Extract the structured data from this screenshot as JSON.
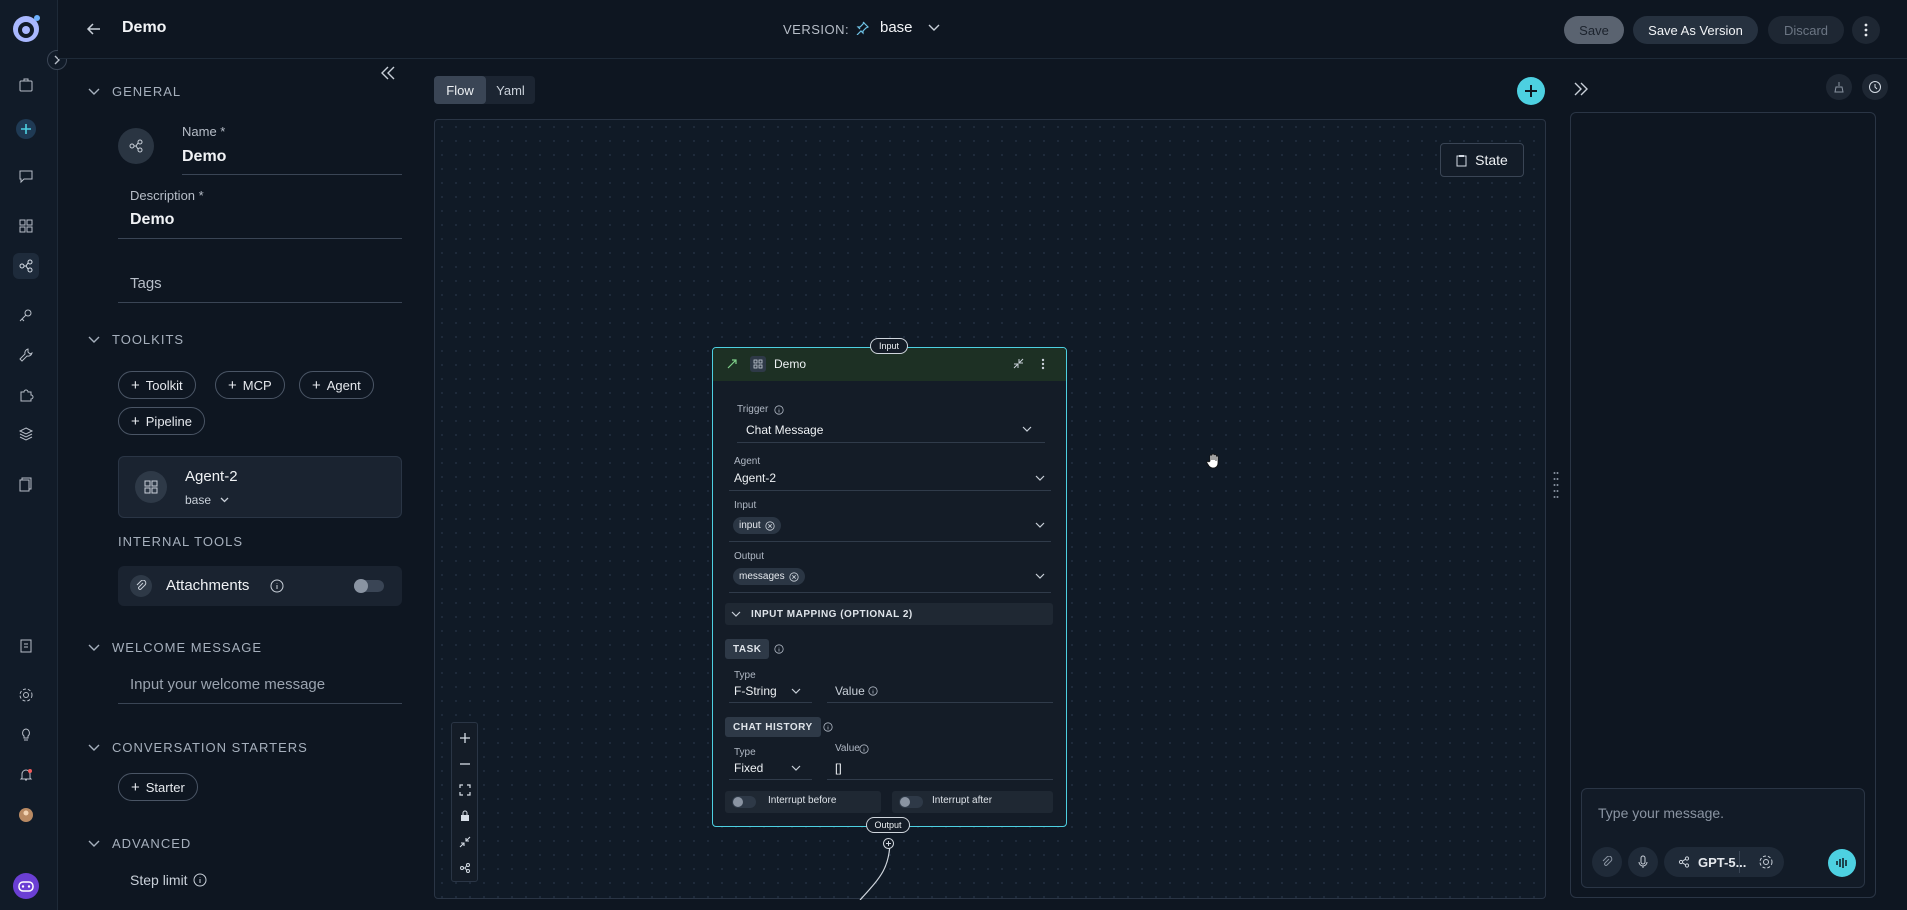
{
  "header": {
    "title": "Demo",
    "version_label": "VERSION:",
    "version_value": "base",
    "save": "Save",
    "save_as_version": "Save As Version",
    "discard": "Discard"
  },
  "general": {
    "section": "GENERAL",
    "name_label": "Name *",
    "name_value": "Demo",
    "description_label": "Description *",
    "description_value": "Demo",
    "tags_placeholder": "Tags"
  },
  "toolkits": {
    "section": "TOOLKITS",
    "buttons": [
      "Toolkit",
      "MCP",
      "Agent",
      "Pipeline"
    ],
    "agent_name": "Agent-2",
    "agent_version": "base"
  },
  "internal_tools": {
    "section": "INTERNAL TOOLS",
    "attachments": "Attachments",
    "attachments_enabled": false
  },
  "welcome": {
    "section": "WELCOME MESSAGE",
    "placeholder": "Input your welcome message"
  },
  "starters": {
    "section": "CONVERSATION STARTERS",
    "button": "Starter"
  },
  "advanced": {
    "section": "ADVANCED",
    "step_limit": "Step limit"
  },
  "canvas": {
    "tabs": [
      "Flow",
      "Yaml"
    ],
    "active_tab": "Flow",
    "state_button": "State"
  },
  "node": {
    "input_handle": "Input",
    "output_handle": "Output",
    "title": "Demo",
    "trigger_label": "Trigger",
    "trigger_value": "Chat Message",
    "agent_label": "Agent",
    "agent_value": "Agent-2",
    "input_label": "Input",
    "input_chip": "input",
    "output_label": "Output",
    "output_chip": "messages",
    "mapping_header": "INPUT MAPPING (OPTIONAL 2)",
    "task_tag": "TASK",
    "task_type_label": "Type",
    "task_type_value": "F-String",
    "task_value_label": "Value",
    "history_tag": "CHAT HISTORY",
    "history_type_label": "Type",
    "history_type_value": "Fixed",
    "history_value_label": "Value",
    "history_value": "[]",
    "interrupt_before": "Interrupt before",
    "interrupt_after": "Interrupt after"
  },
  "chat": {
    "placeholder": "Type your message.",
    "model": "GPT-5..."
  },
  "colors": {
    "accent": "#4dd0e1",
    "node_header": "#1d3024"
  }
}
